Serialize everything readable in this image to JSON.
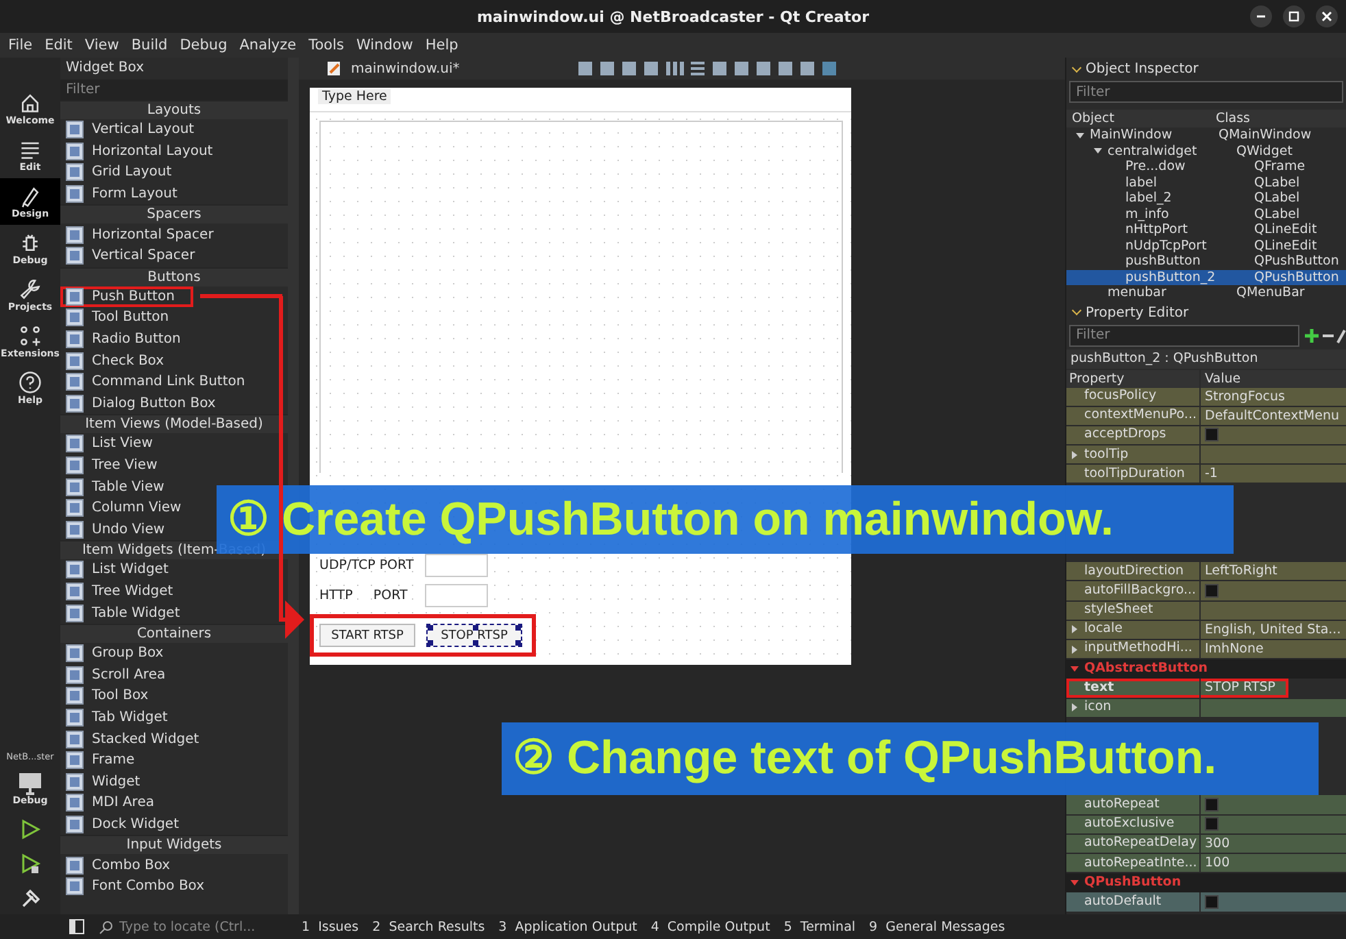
{
  "window": {
    "title": "mainwindow.ui @ NetBroadcaster - Qt Creator"
  },
  "menu": [
    "File",
    "Edit",
    "View",
    "Build",
    "Debug",
    "Analyze",
    "Tools",
    "Window",
    "Help"
  ],
  "mode_bar": {
    "modes": [
      {
        "label": "Welcome",
        "selected": false
      },
      {
        "label": "Edit",
        "selected": false
      },
      {
        "label": "Design",
        "selected": true
      },
      {
        "label": "Debug",
        "selected": false
      },
      {
        "label": "Projects",
        "selected": false
      },
      {
        "label": "Extensions",
        "selected": false
      },
      {
        "label": "Help",
        "selected": false
      }
    ],
    "kit": "NetB...ster",
    "build_mode": "Debug"
  },
  "widget_box": {
    "title": "Widget Box",
    "filter_placeholder": "Filter",
    "categories": [
      {
        "name": "Layouts",
        "items": [
          {
            "label": "Vertical Layout",
            "highlighted": false
          },
          {
            "label": "Horizontal Layout",
            "highlighted": false
          },
          {
            "label": "Grid Layout",
            "highlighted": false
          },
          {
            "label": "Form Layout",
            "highlighted": false
          }
        ]
      },
      {
        "name": "Spacers",
        "items": [
          {
            "label": "Horizontal Spacer",
            "highlighted": false
          },
          {
            "label": "Vertical Spacer",
            "highlighted": false
          }
        ]
      },
      {
        "name": "Buttons",
        "items": [
          {
            "label": "Push Button",
            "highlighted": true
          },
          {
            "label": "Tool Button",
            "highlighted": false
          },
          {
            "label": "Radio Button",
            "highlighted": false
          },
          {
            "label": "Check Box",
            "highlighted": false
          },
          {
            "label": "Command Link Button",
            "highlighted": false
          },
          {
            "label": "Dialog Button Box",
            "highlighted": false
          }
        ]
      },
      {
        "name": "Item Views (Model-Based)",
        "items": [
          {
            "label": "List View",
            "highlighted": false
          },
          {
            "label": "Tree View",
            "highlighted": false
          },
          {
            "label": "Table View",
            "highlighted": false
          },
          {
            "label": "Column View",
            "highlighted": false
          },
          {
            "label": "Undo View",
            "highlighted": false
          }
        ]
      },
      {
        "name": "Item Widgets (Item-Based)",
        "items": [
          {
            "label": "List Widget",
            "highlighted": false
          },
          {
            "label": "Tree Widget",
            "highlighted": false
          },
          {
            "label": "Table Widget",
            "highlighted": false
          }
        ]
      },
      {
        "name": "Containers",
        "items": [
          {
            "label": "Group Box",
            "highlighted": false
          },
          {
            "label": "Scroll Area",
            "highlighted": false
          },
          {
            "label": "Tool Box",
            "highlighted": false
          },
          {
            "label": "Tab Widget",
            "highlighted": false
          },
          {
            "label": "Stacked Widget",
            "highlighted": false
          },
          {
            "label": "Frame",
            "highlighted": false
          },
          {
            "label": "Widget",
            "highlighted": false
          },
          {
            "label": "MDI Area",
            "highlighted": false
          },
          {
            "label": "Dock Widget",
            "highlighted": false
          }
        ]
      },
      {
        "name": "Input Widgets",
        "items": [
          {
            "label": "Combo Box",
            "highlighted": false
          },
          {
            "label": "Font Combo Box",
            "highlighted": false
          }
        ]
      }
    ]
  },
  "editor": {
    "file": "mainwindow.ui*",
    "form": {
      "menu_placeholder": "Type Here",
      "fields": [
        {
          "label": "UDP/TCP PORT"
        },
        {
          "label": "HTTP     PORT"
        }
      ],
      "buttons_highlighted": true,
      "buttons": [
        {
          "label": "START RTSP",
          "selected": false
        },
        {
          "label": "STOP RTSP",
          "selected": true
        }
      ]
    }
  },
  "object_inspector": {
    "title": "Object Inspector",
    "filter_placeholder": "Filter",
    "columns": [
      "Object",
      "Class"
    ],
    "tree": [
      {
        "name": "MainWindow",
        "class": "QMainWindow",
        "selected": false,
        "expanded": true,
        "children": [
          {
            "name": "centralwidget",
            "class": "QWidget",
            "selected": false,
            "expanded": true,
            "children": [
              {
                "name": "Pre...dow",
                "class": "QFrame",
                "selected": false
              },
              {
                "name": "label",
                "class": "QLabel",
                "selected": false
              },
              {
                "name": "label_2",
                "class": "QLabel",
                "selected": false
              },
              {
                "name": "m_info",
                "class": "QLabel",
                "selected": false
              },
              {
                "name": "nHttpPort",
                "class": "QLineEdit",
                "selected": false
              },
              {
                "name": "nUdpTcpPort",
                "class": "QLineEdit",
                "selected": false
              },
              {
                "name": "pushButton",
                "class": "QPushButton",
                "selected": false
              },
              {
                "name": "pushButton_2",
                "class": "QPushButton",
                "selected": true
              }
            ]
          },
          {
            "name": "menubar",
            "class": "QMenuBar",
            "selected": false
          }
        ]
      }
    ]
  },
  "property_editor": {
    "title": "Property Editor",
    "filter_placeholder": "Filter",
    "object": "pushButton_2 : QPushButton",
    "columns": [
      "Property",
      "Value"
    ],
    "groups": [
      {
        "color": "#5c5c3e",
        "rows": [
          {
            "kind": "text",
            "name": "focusPolicy",
            "value": "StrongFocus"
          },
          {
            "kind": "text",
            "name": "contextMenuPo...",
            "value": "DefaultContextMenu"
          },
          {
            "kind": "check",
            "name": "acceptDrops",
            "checked": false
          },
          {
            "kind": "text",
            "name": "toolTip",
            "expandable": true
          },
          {
            "kind": "text",
            "name": "toolTipDuration",
            "value": "-1"
          },
          {
            "kind": "hidden"
          },
          {
            "kind": "hidden"
          },
          {
            "kind": "hidden"
          },
          {
            "kind": "hidden"
          },
          {
            "kind": "text",
            "name": "layoutDirection",
            "value": "LeftToRight"
          },
          {
            "kind": "check",
            "name": "autoFillBackgro...",
            "checked": false
          },
          {
            "kind": "text",
            "name": "styleSheet"
          },
          {
            "kind": "text",
            "name": "locale",
            "value": "English, United Sta...",
            "expandable": true
          },
          {
            "kind": "text",
            "name": "inputMethodHi...",
            "value": "ImhNone",
            "expandable": true
          }
        ]
      },
      {
        "name": "QAbstractButton",
        "color": "#4b5e45",
        "rows": [
          {
            "kind": "text",
            "name": "text",
            "value": "STOP RTSP",
            "bold": true,
            "highlighted": true
          },
          {
            "kind": "text",
            "name": "icon",
            "expandable": true
          },
          {
            "kind": "hidden"
          },
          {
            "kind": "hidden"
          },
          {
            "kind": "hidden"
          },
          {
            "kind": "hidden"
          },
          {
            "kind": "check",
            "name": "autoRepeat",
            "checked": false
          },
          {
            "kind": "check",
            "name": "autoExclusive",
            "checked": false
          },
          {
            "kind": "text",
            "name": "autoRepeatDelay",
            "value": "300"
          },
          {
            "kind": "text",
            "name": "autoRepeatInte...",
            "value": "100"
          }
        ]
      },
      {
        "name": "QPushButton",
        "color": "#4d6463",
        "rows": [
          {
            "kind": "check",
            "name": "autoDefault",
            "checked": false
          }
        ]
      }
    ]
  },
  "status_bar": {
    "locate_placeholder": "Type to locate (Ctrl...",
    "panes": [
      {
        "number": "1",
        "label": "Issues"
      },
      {
        "number": "2",
        "label": "Search Results"
      },
      {
        "number": "3",
        "label": "Application Output"
      },
      {
        "number": "4",
        "label": "Compile Output"
      },
      {
        "number": "5",
        "label": "Terminal"
      },
      {
        "number": "9",
        "label": "General Messages"
      }
    ]
  },
  "annotations": [
    {
      "kind": "banner",
      "text": "① Create QPushButton on mainwindow."
    },
    {
      "kind": "banner",
      "text": "② Change text of QPushButton."
    }
  ]
}
